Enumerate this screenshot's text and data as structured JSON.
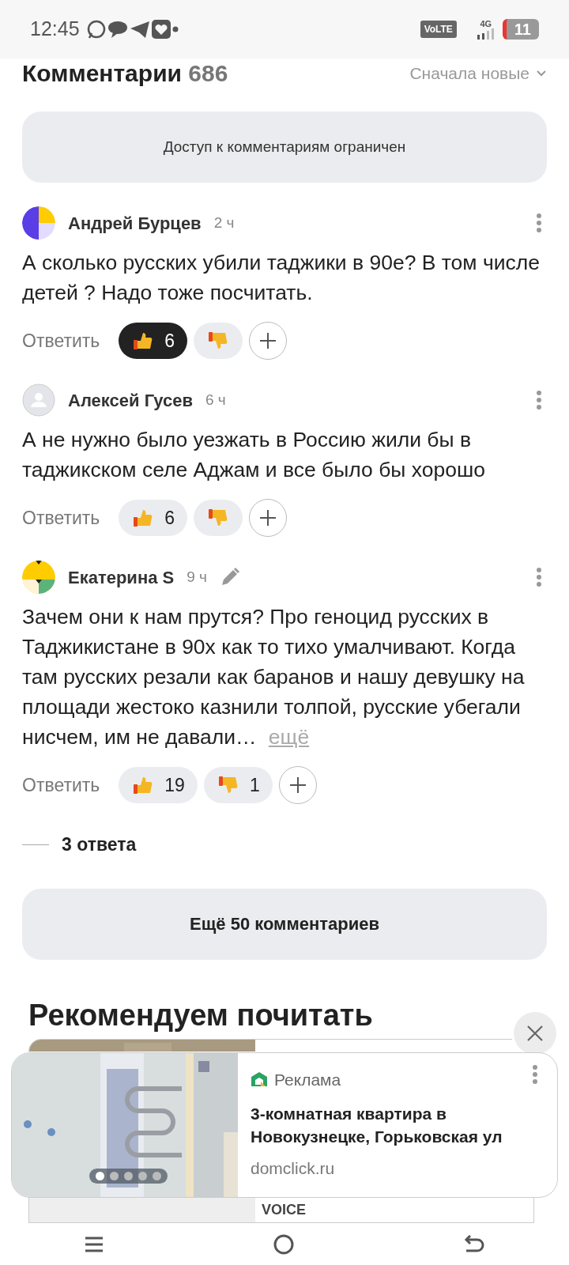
{
  "status_bar": {
    "time": "12:45",
    "volte": "VoLTE",
    "network": "4G",
    "battery": "11"
  },
  "header": {
    "title": "Комментарии",
    "count": "686",
    "sort": "Сначала новые"
  },
  "notice": "Доступ к комментариям ограничен",
  "comments": [
    {
      "avatar": {
        "kind": "abstract"
      },
      "author": "Андрей Бурцев",
      "time": "2 ч",
      "edited": false,
      "text": "А сколько русских убили таджики в 90е? В том числе детей ? Надо тоже посчитать.",
      "reply": "Ответить",
      "likes": {
        "count": "6",
        "selected": true
      },
      "dislikes": {
        "selected": false
      }
    },
    {
      "avatar": {
        "kind": "placeholder"
      },
      "author": "Алексей Гусев",
      "time": "6 ч",
      "edited": false,
      "text": "А не нужно было уезжать в Россию жили бы в таджикском селе Аджам и все было бы хорошо",
      "reply": "Ответить",
      "likes": {
        "count": "6",
        "selected": false
      },
      "dislikes": {
        "selected": false
      }
    },
    {
      "avatar": {
        "kind": "pattern"
      },
      "author": "Екатерина S",
      "time": "9 ч",
      "edited": true,
      "text": "Зачем они к нам прутся? Про геноцид русских в Таджикистане в 90х как то тихо умалчивают. Когда там русских резали как баранов и нашу девушку на площади жестоко казнили толпой, русские убегали нисчем, им не давали…",
      "more": "ещё",
      "reply": "Ответить",
      "likes": {
        "count": "19",
        "selected": false
      },
      "dislikes": {
        "count": "1",
        "selected": false
      }
    }
  ],
  "replies_toggle": "3 ответа",
  "more_button": "Ещё 50 комментариев",
  "recommended": {
    "title": "Рекомендуем почитать",
    "card_source": "VOICE"
  },
  "ad": {
    "label": "Реклама",
    "title": "3-комнатная квартира в Новокузнецке, Горьковская ул",
    "domain": "domclick.ru",
    "slides": [
      {
        "selected": true
      },
      {
        "selected": false
      },
      {
        "selected": false
      },
      {
        "selected": false
      },
      {
        "selected": false
      }
    ]
  }
}
